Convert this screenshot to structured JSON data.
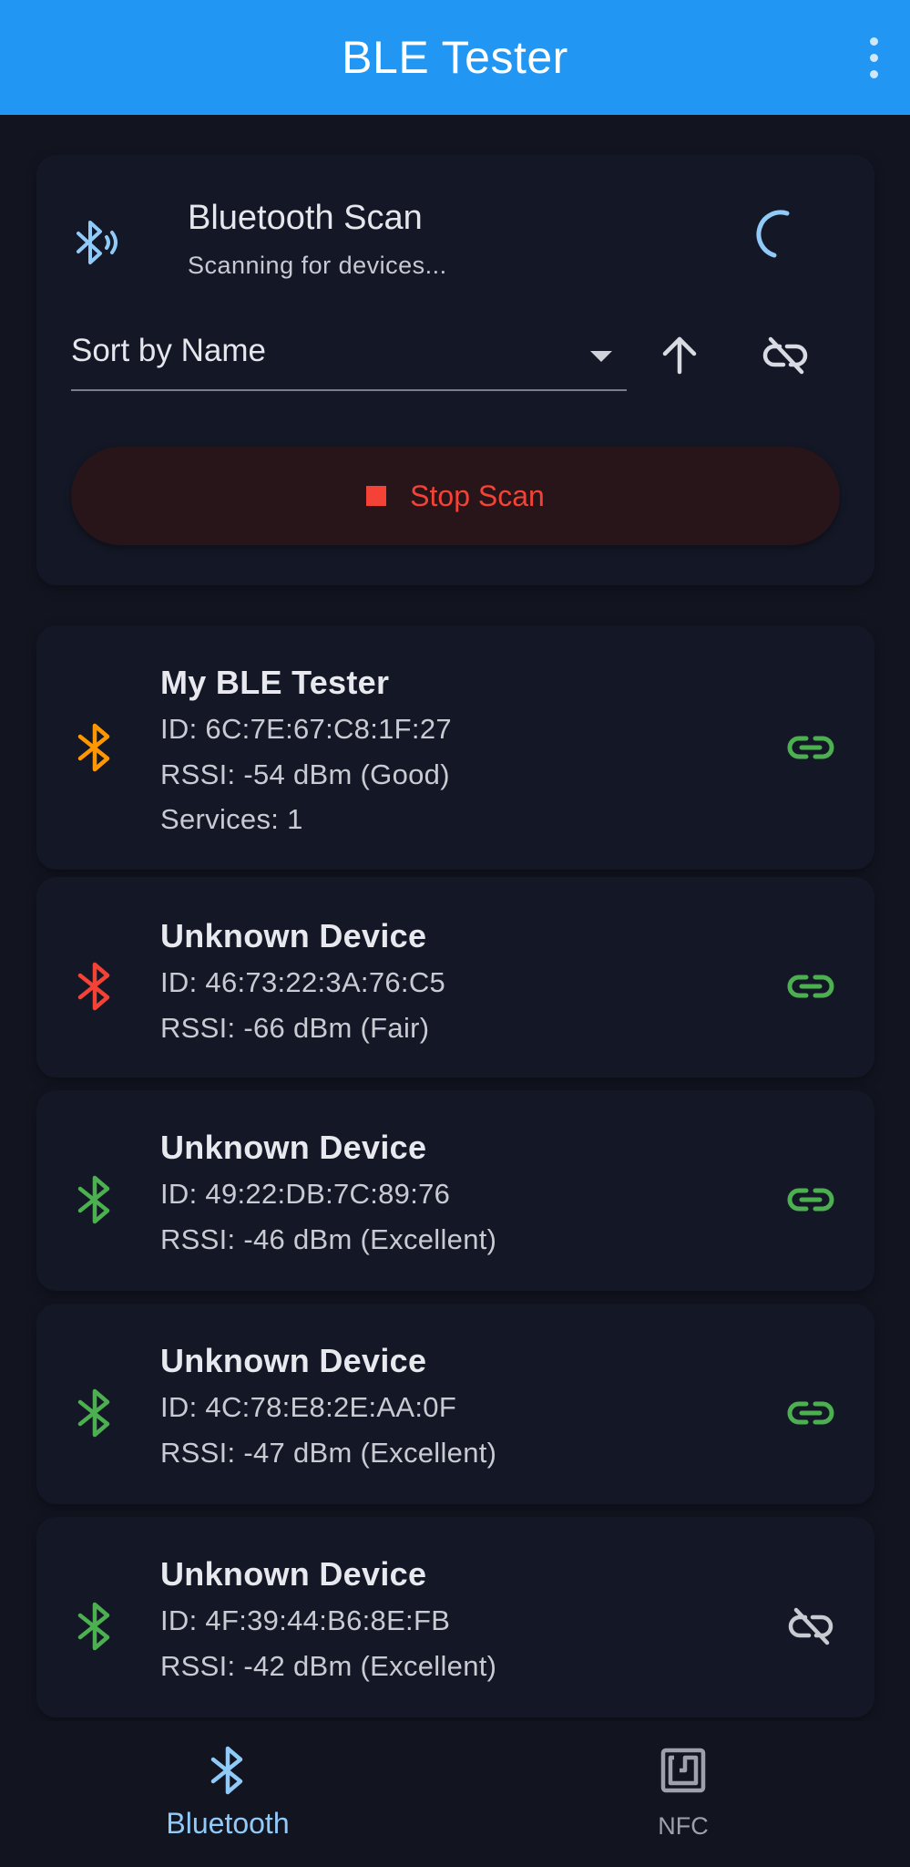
{
  "app": {
    "title": "BLE Tester",
    "menu_icon": "more-vert-icon"
  },
  "scan": {
    "title": "Bluetooth Scan",
    "subtitle": "Scanning for devices...",
    "sort_label": "Sort by Name",
    "stop_label": "Stop Scan"
  },
  "devices": [
    {
      "name": "My BLE Tester",
      "id": "ID: 6C:7E:67:C8:1F:27",
      "rssi": "RSSI: -54 dBm (Good)",
      "services": "Services: 1",
      "color": "#ff9800",
      "connectable": true
    },
    {
      "name": "Unknown Device",
      "id": "ID: 46:73:22:3A:76:C5",
      "rssi": "RSSI: -66 dBm (Fair)",
      "color": "#f44336",
      "connectable": true
    },
    {
      "name": "Unknown Device",
      "id": "ID: 49:22:DB:7C:89:76",
      "rssi": "RSSI: -46 dBm (Excellent)",
      "color": "#4caf50",
      "connectable": true
    },
    {
      "name": "Unknown Device",
      "id": "ID: 4C:78:E8:2E:AA:0F",
      "rssi": "RSSI: -47 dBm (Excellent)",
      "color": "#4caf50",
      "connectable": true
    },
    {
      "name": "Unknown Device",
      "id": "ID: 4F:39:44:B6:8E:FB",
      "rssi": "RSSI: -42 dBm (Excellent)",
      "color": "#4caf50",
      "connectable": false
    }
  ],
  "nav": {
    "items": [
      {
        "label": "Bluetooth",
        "active": true
      },
      {
        "label": "NFC",
        "active": false
      }
    ]
  },
  "colors": {
    "primary": "#2196f3",
    "background": "#121520",
    "card": "#141826",
    "stop": "#f44336",
    "connect": "#4caf50",
    "disabled": "#c9cbd3",
    "nav_active": "#90caf9",
    "nav_inactive": "#9ea1ab"
  }
}
